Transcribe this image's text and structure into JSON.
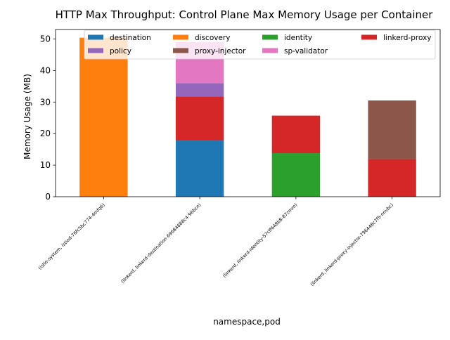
{
  "chart_data": {
    "type": "bar",
    "stacked": true,
    "title": "HTTP Max Throughput: Control Plane Max Memory Usage per Container",
    "xlabel": "namespace,pod",
    "ylabel": "Memory Usage (MB)",
    "ylim": [
      0,
      53
    ],
    "yticks": [
      0,
      10,
      20,
      30,
      40,
      50
    ],
    "grid": false,
    "legend_position": "top",
    "categories": [
      "(istio-system, istiod-76fc5bc774-4mfq6)",
      "(linkerd, linkerd-destination-69684888c4-96bcn)",
      "(linkerd, linkerd-identity-57cff648b8-87zmm)",
      "(linkerd, linkerd-proxy-injector-796448c7f5-nnvbc)"
    ],
    "series": [
      {
        "name": "destination",
        "color": "#1f77b4",
        "values": [
          0,
          17.8,
          0,
          0
        ]
      },
      {
        "name": "discovery",
        "color": "#ff7f0e",
        "values": [
          50.4,
          0,
          0,
          0
        ]
      },
      {
        "name": "identity",
        "color": "#2ca02c",
        "values": [
          0,
          0,
          13.8,
          0
        ]
      },
      {
        "name": "linkerd-proxy",
        "color": "#d62728",
        "values": [
          0,
          14.0,
          11.9,
          11.9
        ]
      },
      {
        "name": "policy",
        "color": "#9467bd",
        "values": [
          0,
          4.2,
          0,
          0
        ]
      },
      {
        "name": "proxy-injector",
        "color": "#8c564b",
        "values": [
          0,
          0,
          0,
          18.6
        ]
      },
      {
        "name": "sp-validator",
        "color": "#e377c2",
        "values": [
          0,
          13.0,
          0,
          0
        ]
      }
    ]
  }
}
